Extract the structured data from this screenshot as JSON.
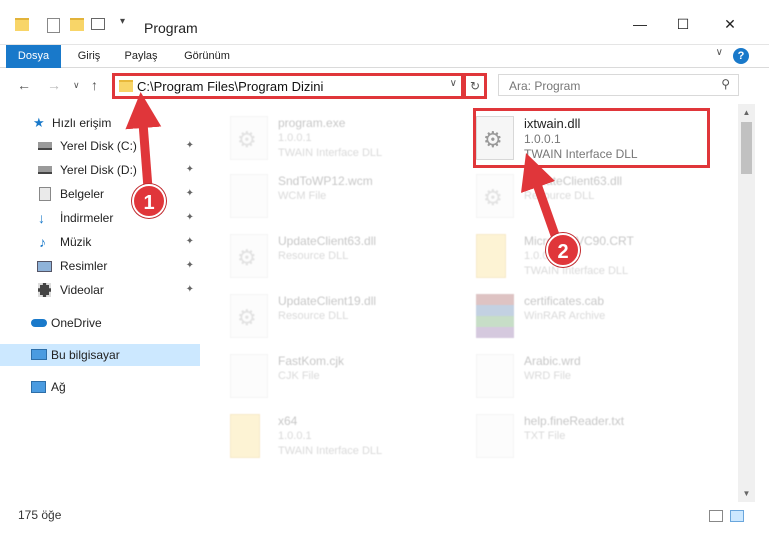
{
  "window": {
    "title": "Program",
    "minimize": "—",
    "maximize": "☐",
    "close": "✕"
  },
  "ribbon": {
    "tabs": [
      "Dosya",
      "Giriş",
      "Paylaş",
      "Görünüm"
    ],
    "help": "?",
    "expand": "∨"
  },
  "nav": {
    "back": "←",
    "forward": "→",
    "recent": "∨",
    "up": "↑",
    "address": "C:\\Program Files\\Program Dizini",
    "address_dropdown": "∨",
    "refresh": "↻",
    "search_placeholder": "Ara: Program",
    "search_icon": "⚲"
  },
  "sidebar": {
    "items": [
      {
        "label": "Hızlı erişim",
        "icon": "star-icon",
        "pinned": false
      },
      {
        "label": "Yerel Disk (C:)",
        "icon": "drive-icon",
        "pinned": true
      },
      {
        "label": "Yerel Disk (D:)",
        "icon": "drive-icon",
        "pinned": true
      },
      {
        "label": "Belgeler",
        "icon": "documents-icon",
        "pinned": true
      },
      {
        "label": "İndirmeler",
        "icon": "download-icon",
        "pinned": true
      },
      {
        "label": "Müzik",
        "icon": "music-icon",
        "pinned": true
      },
      {
        "label": "Resimler",
        "icon": "pictures-icon",
        "pinned": true
      },
      {
        "label": "Videolar",
        "icon": "video-icon",
        "pinned": true
      },
      {
        "label": "OneDrive",
        "icon": "cloud-icon",
        "pinned": false
      },
      {
        "label": "Bu bilgisayar",
        "icon": "computer-icon",
        "pinned": false
      },
      {
        "label": "Ağ",
        "icon": "network-icon",
        "pinned": false
      }
    ],
    "pin_glyph": "📌"
  },
  "files": [
    {
      "name": "program.exe",
      "line2": "1.0.0.1",
      "line3": "TWAIN Interface DLL",
      "icon": "exe-icon"
    },
    {
      "name": "ixtwain.dll",
      "line2": "1.0.0.1",
      "line3": "TWAIN Interface DLL",
      "icon": "dll-icon"
    },
    {
      "name": "SndToWP12.wcm",
      "line2": "WCM File",
      "line3": "",
      "icon": "file-icon"
    },
    {
      "name": "UpdateClient63.dll",
      "line2": "Resource DLL",
      "line3": "",
      "icon": "dll-icon"
    },
    {
      "name": "UpdateClient63.dll",
      "line2": "Resource DLL",
      "line3": "",
      "icon": "dll-icon"
    },
    {
      "name": "Microsoft.VC90.CRT",
      "line2": "1.0.0.1",
      "line3": "TWAIN Interface DLL",
      "icon": "folder-icon"
    },
    {
      "name": "UpdateClient19.dll",
      "line2": "Resource DLL",
      "line3": "",
      "icon": "dll-icon"
    },
    {
      "name": "certificates.cab",
      "line2": "WinRAR Archive",
      "line3": "",
      "icon": "archive-icon"
    },
    {
      "name": "FastKom.cjk",
      "line2": "CJK File",
      "line3": "",
      "icon": "file-icon"
    },
    {
      "name": "Arabic.wrd",
      "line2": "WRD File",
      "line3": "",
      "icon": "file-icon"
    },
    {
      "name": "x64",
      "line2": "1.0.0.1",
      "line3": "TWAIN Interface DLL",
      "icon": "folder-icon"
    },
    {
      "name": "help.fineReader.txt",
      "line2": "TXT File",
      "line3": "",
      "icon": "file-icon"
    }
  ],
  "status": {
    "count": "175 öğe"
  },
  "annotations": {
    "badge1": "1",
    "badge2": "2",
    "color": "#e0363a"
  }
}
